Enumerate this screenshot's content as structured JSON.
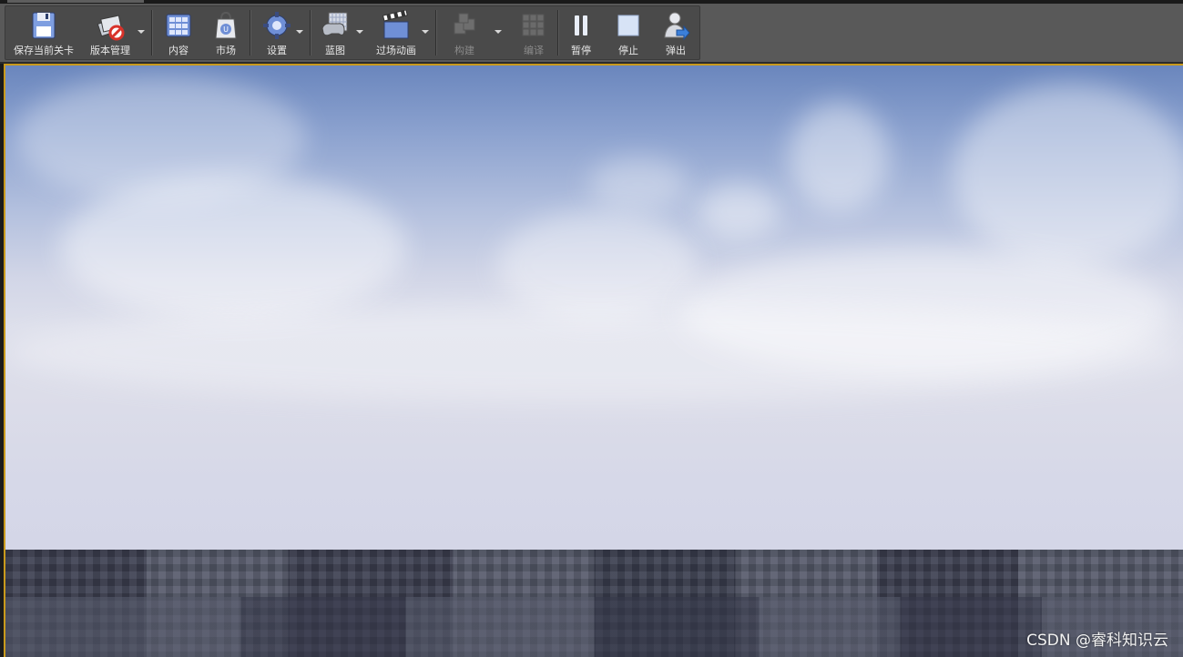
{
  "toolbar": {
    "save_current_level": "保存当前关卡",
    "version_control": "版本管理",
    "content": "内容",
    "marketplace": "市场",
    "settings": "设置",
    "blueprints": "蓝图",
    "cinematics": "过场动画",
    "build": "构建",
    "compile": "编译",
    "pause": "暂停",
    "stop": "停止",
    "eject": "弹出"
  },
  "watermark": "CSDN @睿科知识云",
  "colors": {
    "viewport_border": "#c99a1c",
    "toolbar_bg": "#4a4a4a",
    "icon_blue": "#6f8fd6"
  }
}
